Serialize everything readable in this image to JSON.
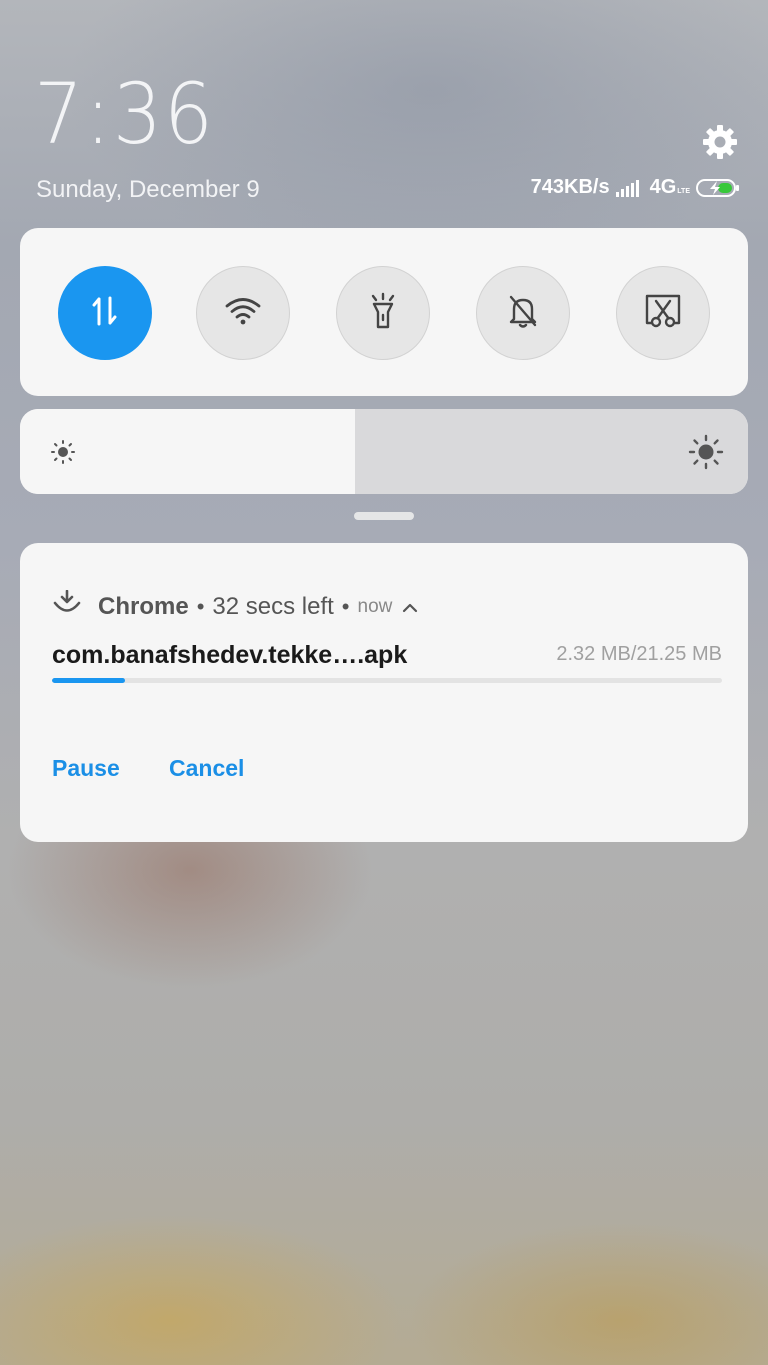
{
  "lockscreen": {
    "time": "7:36",
    "date": "Sunday, December 9"
  },
  "status": {
    "network_speed": "743KB/s",
    "network_type": "4G",
    "network_sub": "LTE",
    "battery": "charging"
  },
  "quick_toggles": [
    {
      "name": "mobile-data",
      "icon": "data-arrows-icon",
      "active": true
    },
    {
      "name": "wifi",
      "icon": "wifi-icon",
      "active": false
    },
    {
      "name": "flashlight",
      "icon": "flashlight-icon",
      "active": false
    },
    {
      "name": "mute",
      "icon": "bell-off-icon",
      "active": false
    },
    {
      "name": "screenshot",
      "icon": "scissors-icon",
      "active": false
    }
  ],
  "brightness": {
    "level": 0.46
  },
  "notification": {
    "app": "Chrome",
    "time_left": "32 secs left",
    "when": "now",
    "filename": "com.banafshedev.tekke….apk",
    "size": "2.32 MB/21.25 MB",
    "progress": 0.109,
    "actions": {
      "pause": "Pause",
      "cancel": "Cancel"
    }
  },
  "colors": {
    "accent": "#1a96f0",
    "action_text": "#1b8fe6"
  }
}
